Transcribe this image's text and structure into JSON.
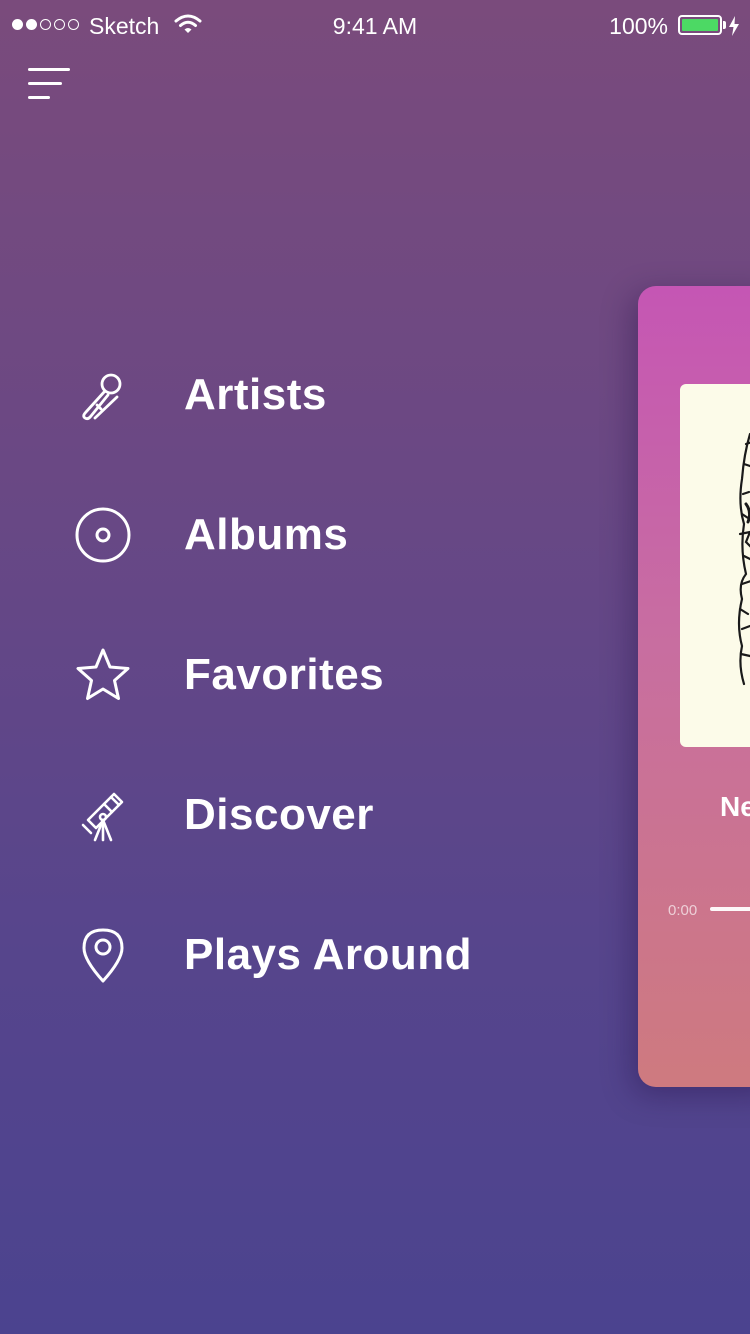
{
  "status_bar": {
    "carrier": "Sketch",
    "time": "9:41 AM",
    "battery": "100%",
    "signal_bars_filled": 2,
    "signal_bars_total": 5
  },
  "header": {
    "menu_icon": "hamburger-menu-icon"
  },
  "nav": {
    "items": [
      {
        "label": "Artists",
        "icon": "microphone-icon"
      },
      {
        "label": "Albums",
        "icon": "disc-icon"
      },
      {
        "label": "Favorites",
        "icon": "star-icon"
      },
      {
        "label": "Discover",
        "icon": "telescope-icon"
      },
      {
        "label": "Plays Around",
        "icon": "location-pin-icon"
      }
    ]
  },
  "player": {
    "title_visible": "Ne",
    "elapsed": "0:00"
  },
  "colors": {
    "bg_top": "#7a4b7c",
    "bg_bottom": "#4b438f",
    "card_top": "#c556b4",
    "card_bottom": "#ce7a7f",
    "battery": "#4cd964"
  }
}
